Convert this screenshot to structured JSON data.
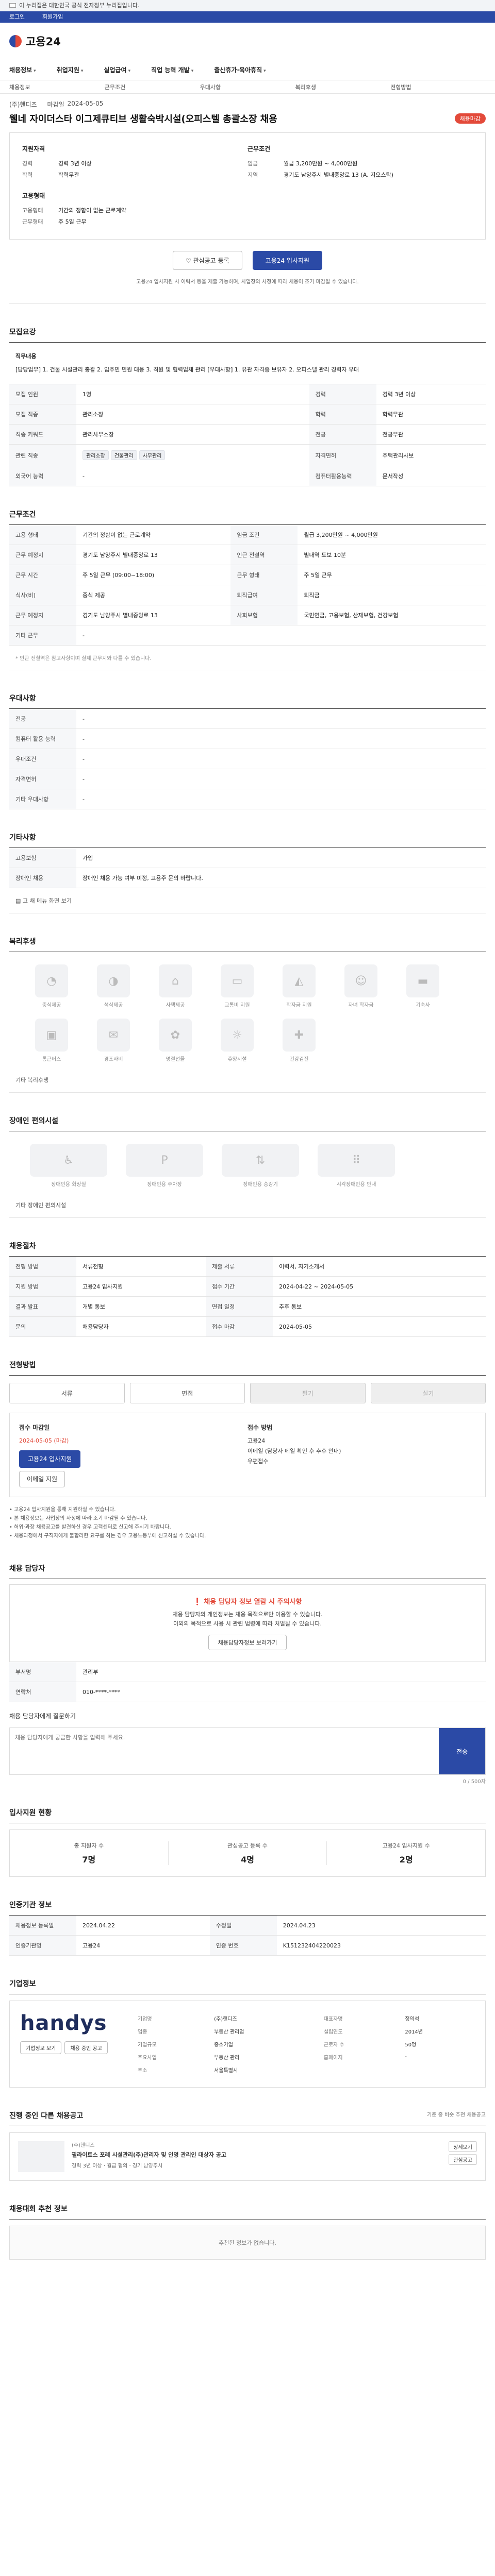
{
  "gov_banner": {
    "text": "이 누리집은 대한민국 공식 전자정부 누리집입니다."
  },
  "util": {
    "items": [
      "로그인",
      "회원가입"
    ]
  },
  "logo": {
    "text": "고용24"
  },
  "gnb": {
    "items": [
      "채용정보",
      "취업지원",
      "실업급여",
      "직업 능력 개발",
      "출산휴가·육아휴직"
    ]
  },
  "subnav": {
    "items": [
      "채용정보",
      "근무조건",
      "우대사항",
      "복리후생",
      "전형방법"
    ]
  },
  "job": {
    "company": "(주)핸디즈",
    "deadline_label": "마감일",
    "deadline": "2024-05-05",
    "title": "웰네 자이더스타 이그제큐티브 생활숙박시설(오피스텔 총괄소장 채용",
    "status": "채용마감"
  },
  "summary": {
    "left_title": "지원자격",
    "rows_left": [
      [
        "경력",
        "경력 3년 이상"
      ],
      [
        "학력",
        "학력무관"
      ]
    ],
    "right_title": "근무조건",
    "rows_right": [
      [
        "임금",
        "월급 3,200만원 ~ 4,000만원"
      ],
      [
        "지역",
        "경기도 남양주시 별내중앙로 13 (A, 지오스탁)"
      ]
    ],
    "left_title2": "고용형태",
    "rows_left2": [
      [
        "고용형태",
        "기간의 정함이 없는 근로계약"
      ],
      [
        "근무형태",
        "주 5일 근무"
      ]
    ]
  },
  "actions": {
    "scrap": "관심공고 등록",
    "apply": "고용24 입사지원"
  },
  "notice": "고용24 입사지원 시 이력서 등을 제출 가능하며, 사업장의 사정에 따라 채용이 조기 마감될 수 있습니다.",
  "recruit": {
    "section": "모집요강",
    "duty_label": "직무내용",
    "duty_text": "[담당업무] 1. 건물 시설관리 총괄 2. 입주민 민원 대응 3. 직원 및 협력업체 관리 [우대사항] 1. 유관 자격증 보유자 2. 오피스텔 관리 경력자 우대",
    "rows": [
      [
        "모집 인원",
        "1명",
        "경력",
        "경력 3년 이상"
      ],
      [
        "모집 직종",
        "관리소장",
        "학력",
        "학력무관"
      ],
      [
        "직종 키워드",
        "관리사무소장",
        "전공",
        "전공무관"
      ],
      [
        "관련 직종",
        "건물관리",
        "자격면허",
        "주택관리사보"
      ],
      [
        "외국어 능력",
        "-",
        "컴퓨터활용능력",
        "문서작성"
      ]
    ],
    "chips": [
      "관리소장",
      "건물관리",
      "사무관리"
    ]
  },
  "work": {
    "section": "근무조건",
    "rows": [
      [
        "고용 형태",
        "기간의 정함이 없는 근로계약",
        "임금 조건",
        "월급 3,200만원 ~ 4,000만원"
      ],
      [
        "근무 예정지",
        "경기도 남양주시 별내중앙로 13",
        "인근 전철역",
        "별내역 도보 10분"
      ],
      [
        "근무 시간",
        "주 5일 근무 (09:00~18:00)",
        "근무 형태",
        "주 5일 근무"
      ],
      [
        "식사(비)",
        "중식 제공",
        "퇴직급여",
        "퇴직금"
      ],
      [
        "근무 예정지",
        "경기도 남양주시 별내중앙로 13",
        "사회보험",
        "국민연금, 고용보험, 산재보험, 건강보험"
      ],
      [
        "기타 근무",
        "-",
        "",
        ""
      ]
    ],
    "note": "* 인근 전철역은 참고사항이며 실제 근무지와 다를 수 있습니다."
  },
  "pref": {
    "section": "우대사항",
    "rows": [
      [
        "전공",
        "-"
      ],
      [
        "컴퓨터 활용 능력",
        "-"
      ],
      [
        "우대조건",
        "-"
      ],
      [
        "자격면허",
        "-"
      ],
      [
        "기타 우대사항",
        "-"
      ]
    ]
  },
  "etc": {
    "section": "기타사항",
    "rows": [
      [
        "고용보험",
        "가입"
      ],
      [
        "장애인 채용",
        "장애인 채용 가능 여부 미정, 고용주 문의 바랍니다."
      ]
    ],
    "link": "고 채 메뉴 화면 보기"
  },
  "welfare": {
    "section": "복리후생",
    "icons": [
      "중식제공",
      "석식제공",
      "사택제공",
      "교통비 지원",
      "학자금 지원",
      "자녀 학자금",
      "기숙사",
      "통근버스",
      "경조사비",
      "명절선물",
      "휴양시설",
      "건강검진"
    ],
    "empty": "기타 복리후생"
  },
  "disability": {
    "section": "장애인 편의시설",
    "icons": [
      "장애인용 화장실",
      "장애인용 주차장",
      "장애인용 승강기",
      "시각장애인용 안내"
    ],
    "empty": "기타 장애인 편의시설"
  },
  "process": {
    "section": "채용절차",
    "rows": [
      [
        "전형 방법",
        "서류전형",
        "제출 서류",
        "이력서, 자기소개서"
      ],
      [
        "지원 방법",
        "고용24 입사지원",
        "접수 기간",
        "2024-04-22 ~ 2024-05-05"
      ],
      [
        "결과 발표",
        "개별 통보",
        "면접 일정",
        "추후 통보"
      ],
      [
        "문의",
        "채용담당자",
        "접수 마감",
        "2024-05-05"
      ]
    ]
  },
  "method": {
    "section": "전형방법",
    "tabs": [
      "서류",
      "면접",
      "필기",
      "실기"
    ],
    "left_title": "접수 마감일",
    "left_date": "2024-05-05 (마감)",
    "apply": "고용24 입사지원",
    "mail": "이메일 지원",
    "right_title": "접수 방법",
    "right_lines": [
      "고용24",
      "이메일 (담당자 메일 확인 후 추후 안내)",
      "우편접수"
    ]
  },
  "bullets": [
    "• 고용24 입사지원을 통해 지원하실 수 있습니다.",
    "• 본 채용정보는 사업장의 사정에 따라 조기 마감될 수 있습니다.",
    "• 허위·과장 채용공고를 발견하신 경우 고객센터로 신고해 주시기 바랍니다.",
    "• 채용과정에서 구직자에게 불합리한 요구를 하는 경우 고용노동부에 신고하실 수 있습니다."
  ],
  "manager": {
    "section": "채용 담당자",
    "warn": "채용 담당자 정보 열람 시 주의사항",
    "lines": [
      "채용 담당자의 개인정보는 채용 목적으로만 이용할 수 있습니다.",
      "이외의 목적으로 사용 시 관련 법령에 따라 처벌될 수 있습니다."
    ],
    "button": "채용담당자정보 보러가기",
    "rows": [
      [
        "부서명",
        "관리부"
      ],
      [
        "연락처",
        "010-****-****"
      ]
    ]
  },
  "inquiry": {
    "label": "채용 담당자에게 질문하기",
    "placeholder": "채용 담당자에게 궁금한 사항을 입력해 주세요.",
    "send": "전송",
    "count": "0 / 500자"
  },
  "status": {
    "section": "입사지원 현황",
    "items": [
      [
        "총 지원자 수",
        "7명"
      ],
      [
        "관심공고 등록 수",
        "4명"
      ],
      [
        "고용24 입사지원 수",
        "2명"
      ]
    ]
  },
  "agency": {
    "section": "인증기관 정보",
    "rows": [
      [
        "채용정보 등록일",
        "2024.04.22",
        "수정일",
        "2024.04.23"
      ],
      [
        "인증기관명",
        "고용24",
        "인증 번호",
        "K151232404220023"
      ]
    ]
  },
  "company": {
    "section": "기업정보",
    "logo_text": "handys",
    "btn1": "기업정보 보기",
    "btn2": "채용 중인 공고",
    "rows": [
      [
        "기업명",
        "(주)핸디즈",
        "대표자명",
        "정의석"
      ],
      [
        "업종",
        "부동산 관리업",
        "설립연도",
        "2014년"
      ],
      [
        "기업규모",
        "중소기업",
        "근로자 수",
        "50명"
      ],
      [
        "주요사업",
        "부동산 관리",
        "홈페이지",
        "-"
      ],
      [
        "주소",
        "서울특별시",
        "",
        ""
      ]
    ]
  },
  "recommend": {
    "section": "진행 중인 다른 채용공고",
    "sub": "기준 중 비슷 추천 채용공고",
    "company": "(주)핸디즈",
    "title": "필라이트스 포레 시설관리(주)관리자 및 인명 관리인 대상자 공고",
    "meta": [
      "경력 3년 이상",
      "월급 협의",
      "경기 남양주시"
    ],
    "side": [
      "상세보기",
      "관심공고"
    ]
  },
  "youth": {
    "section": "채용대회 추천 정보",
    "empty": "추천된 정보가 없습니다."
  }
}
